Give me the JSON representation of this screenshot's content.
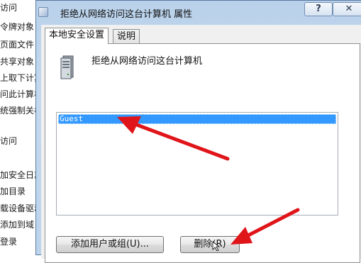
{
  "background": {
    "items": [
      "访问",
      "令牌对象",
      "页面文件",
      "共享对象",
      "上取下计算",
      "问此计算机",
      "统强制关机",
      "访问",
      "加安全日志",
      "加目录",
      "载设备驱动",
      "添加到域",
      "登录"
    ]
  },
  "dialog": {
    "title": "拒绝从网络访问这台计算机 属性",
    "help_label": "?",
    "close_label": "✕",
    "tabs": [
      {
        "label": "本地安全设置"
      },
      {
        "label": "说明"
      }
    ],
    "policy_name": "拒绝从网络访问这台计算机",
    "list_items": [
      "Guest"
    ],
    "add_button_label": "添加用户或组(U)...",
    "remove_button_label": "删除(R)"
  },
  "annotations": {
    "arrow_color": "#e0151a",
    "icon": "server-icon"
  }
}
